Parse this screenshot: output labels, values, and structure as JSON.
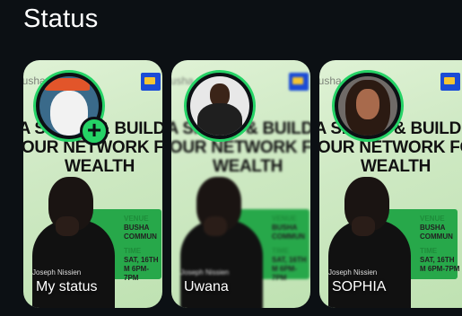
{
  "header": {
    "title": "Status"
  },
  "cards": [
    {
      "label": "My status",
      "headline": "MA SKILLS & BUILDING YOUR NETWORK FOR WEALTH",
      "add_icon": "plus"
    },
    {
      "label": "Uwana",
      "headline": "MA SKILLS & BUILDING YOUR NETWORK FOR WEALTH"
    },
    {
      "label": "SOPHIA",
      "headline": "MA SKILLS & BUILDING YOUR NETWORK FOR WEALTH"
    }
  ],
  "flyer": {
    "brand": "busha",
    "venue_label": "VENUE",
    "venue_value": "BUSHA COMMUN",
    "time_label": "TIME",
    "time_value": "SAT, 16TH M 6PM-7PM",
    "speaker": "Joseph Nissien"
  },
  "colors": {
    "accent": "#25d366",
    "background": "#0c1014"
  }
}
